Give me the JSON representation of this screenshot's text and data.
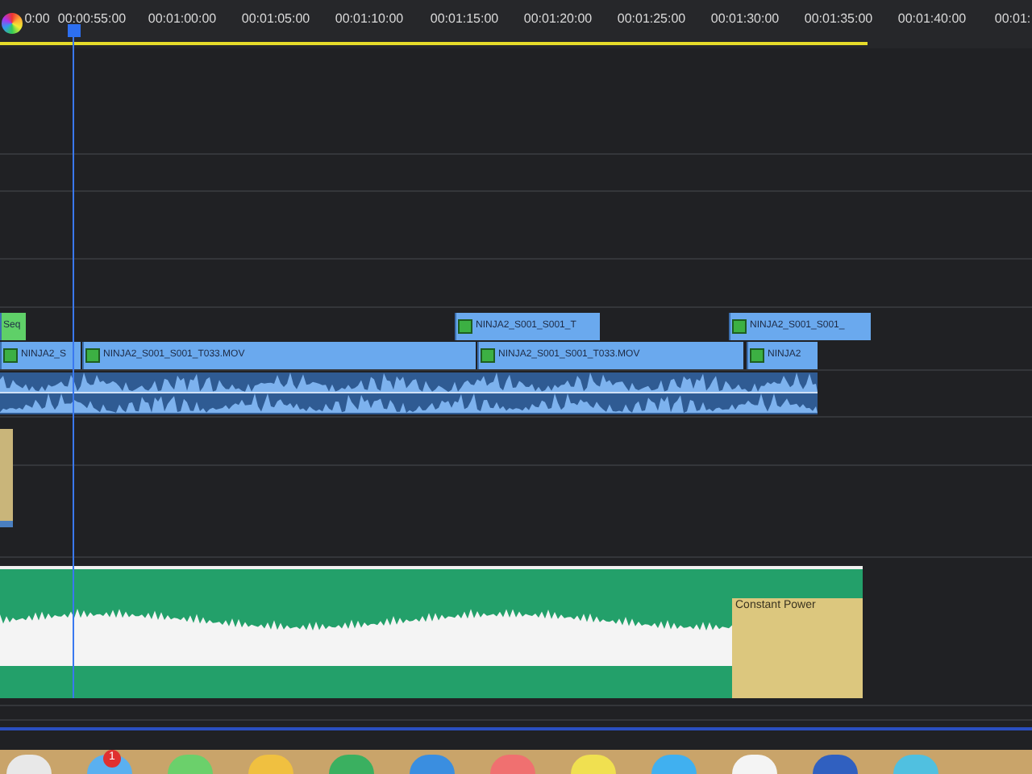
{
  "ruler": {
    "timecodes": [
      "0:00",
      "00:00:55:00",
      "00:01:00:00",
      "00:01:05:00",
      "00:01:10:00",
      "00:01:15:00",
      "00:01:20:00",
      "00:01:25:00",
      "00:01:30:00",
      "00:01:35:00",
      "00:01:40:00",
      "00:01:"
    ]
  },
  "video_track_upper": [
    {
      "kind": "nested",
      "label": "Seq"
    },
    {
      "kind": "video",
      "label": "NINJA2_S001_S001_T"
    },
    {
      "kind": "video",
      "label": "NINJA2_S001_S001_"
    }
  ],
  "video_track_lower": [
    {
      "kind": "video",
      "label": "NINJA2_S"
    },
    {
      "kind": "video",
      "label": "NINJA2_S001_S001_T033.MOV"
    },
    {
      "kind": "video",
      "label": "NINJA2_S001_S001_T033.MOV"
    },
    {
      "kind": "video",
      "label": "NINJA2"
    }
  ],
  "music_clip": {
    "transition": "Constant Power"
  },
  "dock": {
    "badge": "1"
  }
}
